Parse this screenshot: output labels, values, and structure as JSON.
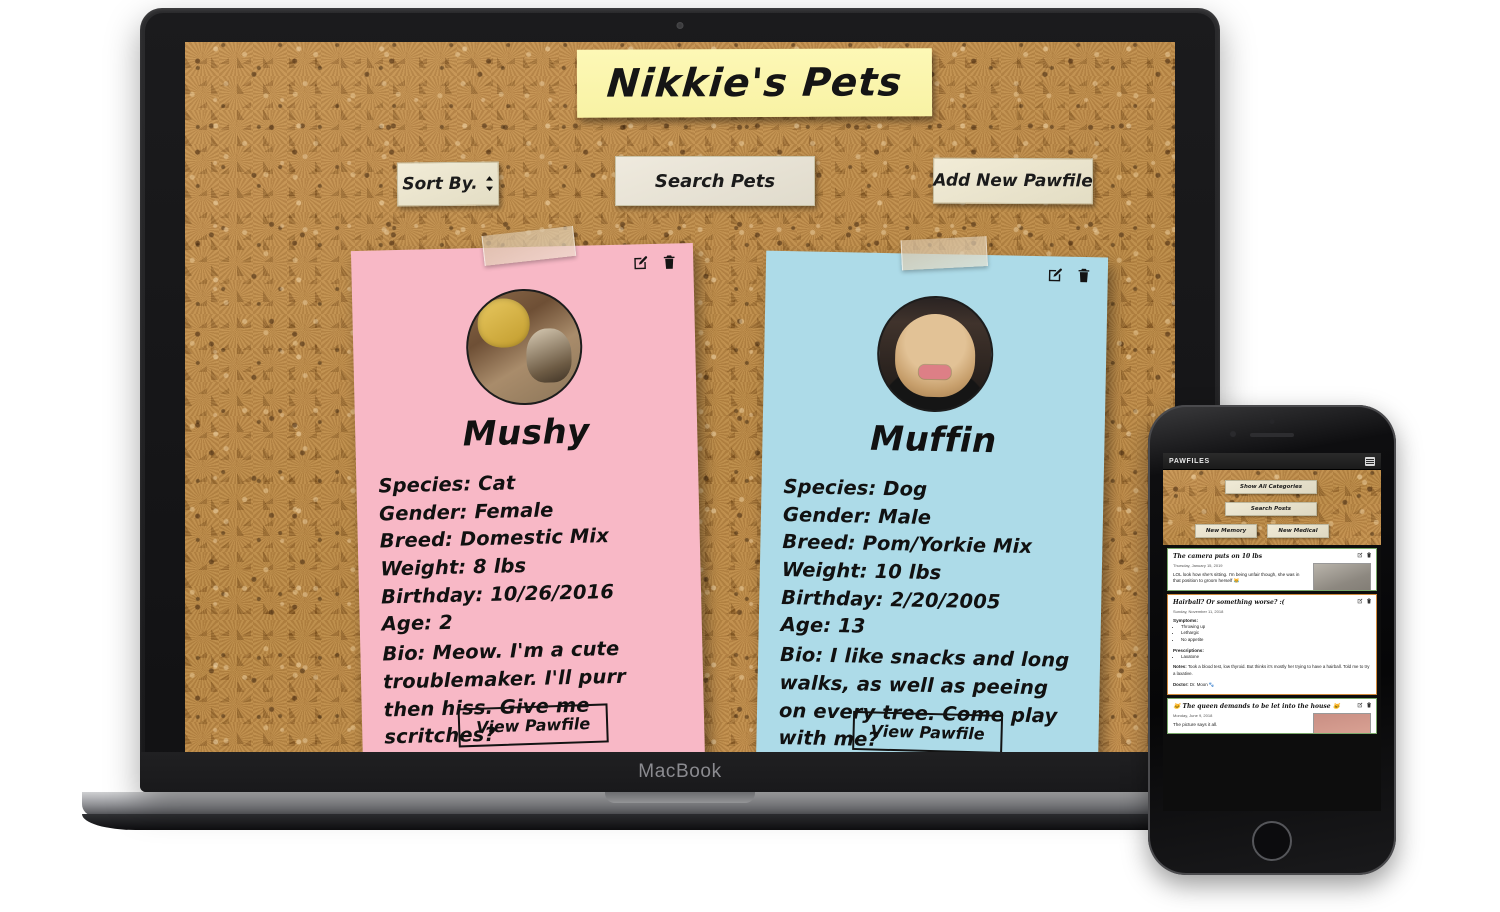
{
  "device": {
    "laptop_wordmark": "MacBook"
  },
  "desktop": {
    "header": {
      "title": "Nikkie's Pets"
    },
    "toolbar": {
      "sort_label": "Sort By.",
      "search_label": "Search Pets",
      "add_label": "Add New Pawfile"
    },
    "labels": {
      "species": "Species:",
      "gender": "Gender:",
      "breed": "Breed:",
      "weight": "Weight:",
      "birthday": "Birthday:",
      "age": "Age:",
      "bio": "Bio:",
      "view": "View Pawfile",
      "edit_icon": "edit-icon",
      "delete_icon": "trash-icon"
    },
    "pets": [
      {
        "name": "Mushy",
        "species": "Cat",
        "gender": "Female",
        "breed": "Domestic Mix",
        "weight": "8 lbs",
        "birthday": "10/26/2016",
        "age": "2",
        "bio": "Meow. I'm a cute troublemaker. I'll purr then hiss. Give me scritches?",
        "color": "#f8b8c6",
        "photo_alt": "cat-with-gold-balloon"
      },
      {
        "name": "Muffin",
        "species": "Dog",
        "gender": "Male",
        "breed": "Pom/Yorkie Mix",
        "weight": "10 lbs",
        "birthday": "2/20/2005",
        "age": "13",
        "bio": "I like snacks and long walks, as well as peeing on every tree. Come play with me?",
        "color": "#addbe8",
        "photo_alt": "yorkie-with-pink-bowtie"
      }
    ]
  },
  "phone": {
    "nav": {
      "title": "PAWFILES",
      "menu_icon": "hamburger-icon"
    },
    "buttons": {
      "categories": "Show All Categories",
      "search": "Search Posts",
      "new_memory": "New Memory",
      "new_medical": "New Medical"
    },
    "posts": [
      {
        "type": "memory",
        "title": "The camera puts on 10 lbs",
        "date": "Thursday, January 15, 2019",
        "body": "LOL look how she's sitting. I'm being unfair though, she was in that position to groom herself 😹",
        "thumb_alt": "cat-sitting-photo"
      },
      {
        "type": "medical",
        "title": "Hairball? Or something worse? :(",
        "date": "Sunday, November 11, 2018",
        "symptoms_label": "Symptoms:",
        "symptoms": [
          "Throwing up",
          "Lethargic",
          "No appetite"
        ],
        "prescriptions_label": "Prescriptions:",
        "prescriptions": [
          "Laxatone"
        ],
        "notes_label": "Notes:",
        "notes": "Took a blood test, low thyroid. But thinks it's mostly her trying to have a hairball. Told me to try a laxative.",
        "doctor_label": "Doctor:",
        "doctor": "Dr. Moon 🐾"
      },
      {
        "type": "memory",
        "title": "🐱 The queen demands to be let into the house 🐱",
        "date": "Monday, June 9, 2018",
        "body": "The picture says it all.",
        "thumb_alt": "cat-yelling-at-door-photo"
      }
    ]
  }
}
